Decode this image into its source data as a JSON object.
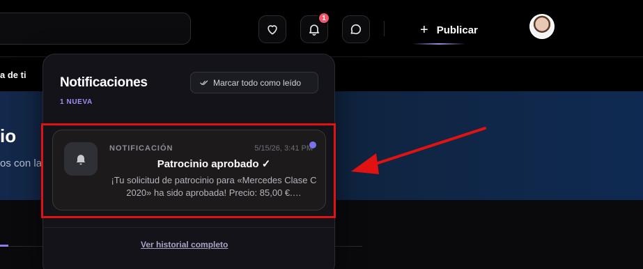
{
  "topbar": {
    "notification_badge": "1",
    "publish_label": "Publicar",
    "icons": {
      "favorites": "heart-icon",
      "notifications": "bell-icon",
      "messages": "chat-bubble-icon",
      "publish": "plus-icon"
    }
  },
  "background": {
    "subnav_text": "a de ti",
    "hero_title": "io",
    "hero_subtitle": "os con la"
  },
  "notifications_panel": {
    "title": "Notificaciones",
    "new_count": "1 NUEVA",
    "mark_all_read_label": "Marcar todo como leído",
    "items": [
      {
        "type": "NOTIFICACIÓN",
        "timestamp": "5/15/26, 3:41 PM",
        "title": "Patrocinio aprobado ✓",
        "body": "¡Tu solicitud de patrocinio para «Mercedes Clase C 2020» ha sido aprobada! Precio: 85,00 €.…",
        "icon": "bell-icon",
        "unread": true
      }
    ],
    "history_link": "Ver historial completo"
  },
  "colors": {
    "accent": "#9d92f5",
    "badge": "#f2546a",
    "annotation": "#e01212",
    "hero_blue": "#13284a"
  }
}
